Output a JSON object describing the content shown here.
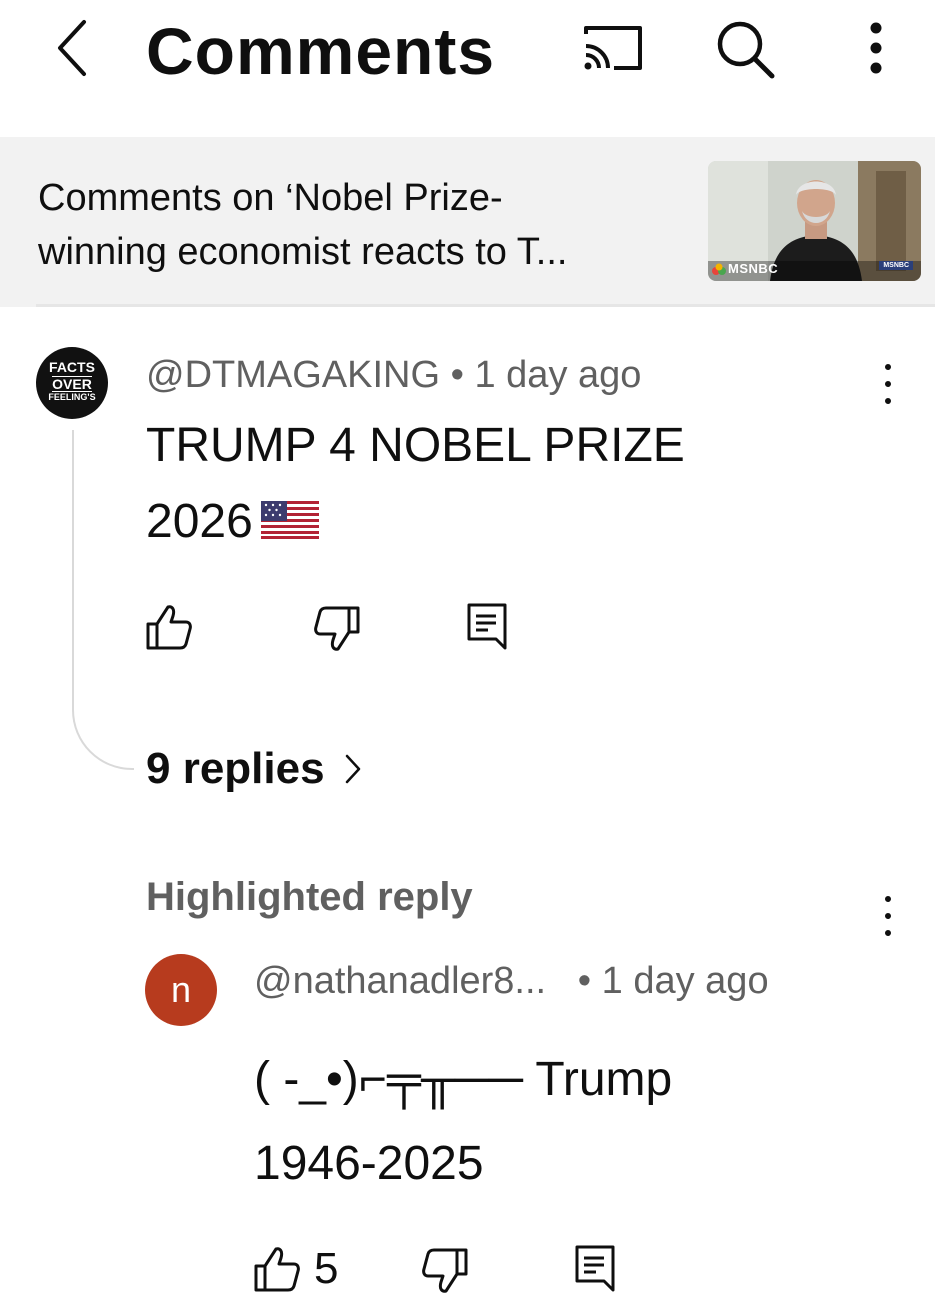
{
  "header": {
    "title": "Comments",
    "back_icon": "chevron-left-icon",
    "cast_icon": "cast-icon",
    "search_icon": "search-icon",
    "more_icon": "more-vertical-icon"
  },
  "video": {
    "title_line1": "Comments on ‘Nobel Prize-",
    "title_line2": "winning economist reacts to T...",
    "thumbnail_brand": "MSNBC",
    "thumbnail_badge": "MSNBC"
  },
  "comment": {
    "avatar_text": [
      "FACTS",
      "OVER",
      "FEELING'S"
    ],
    "author": "@DTMAGAKING",
    "time": "1 day ago",
    "text_line1": "TRUMP 4 NOBEL PRIZE",
    "text_line2": "2026",
    "flag": "🇺🇸",
    "replies_label": "9 replies"
  },
  "highlighted_reply": {
    "label": "Highlighted reply",
    "avatar_letter": "n",
    "author": "@nathanadler8...",
    "time": "1 day ago",
    "text_line1": "( -_•)⌐╤╥── Trump",
    "text_line2": "1946-2025",
    "like_count": "5"
  },
  "colors": {
    "text": "#0f0f0f",
    "secondary_text": "#606060",
    "banner_bg": "#f2f2f2",
    "avatar_n": "#b73b1e"
  }
}
